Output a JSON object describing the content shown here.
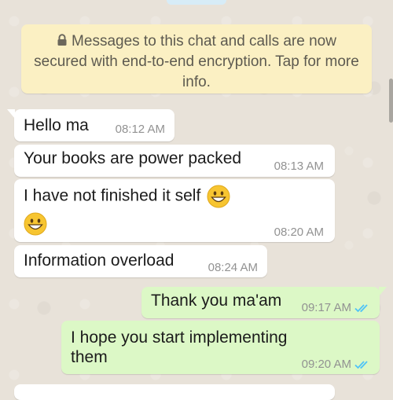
{
  "encryption_notice": {
    "icon": "lock-icon",
    "text": "Messages to this chat and calls are now secured with end-to-end encryption. Tap for more info."
  },
  "messages": [
    {
      "direction": "incoming",
      "text": "Hello ma",
      "time": "08:12 AM"
    },
    {
      "direction": "incoming",
      "text": "Your books are power packed",
      "time": "08:13 AM"
    },
    {
      "direction": "incoming",
      "text": "I have not finished it self",
      "emoji": "grinning-face-emoji",
      "time": "08:20 AM"
    },
    {
      "direction": "incoming",
      "text": "Information overload",
      "time": "08:24 AM"
    },
    {
      "direction": "outgoing",
      "text": "Thank you ma'am",
      "time": "09:17 AM",
      "status": "read"
    },
    {
      "direction": "outgoing",
      "text_lines": [
        "I hope you start implementing",
        "them"
      ],
      "time": "09:20 AM",
      "status": "read"
    }
  ],
  "colors": {
    "wallpaper": "#e8e2d9",
    "incoming_bubble": "#ffffff",
    "outgoing_bubble": "#dcf8c6",
    "notice_bubble": "#fbf0c3",
    "read_tick": "#4fc3f7",
    "timestamp": "#929292"
  }
}
